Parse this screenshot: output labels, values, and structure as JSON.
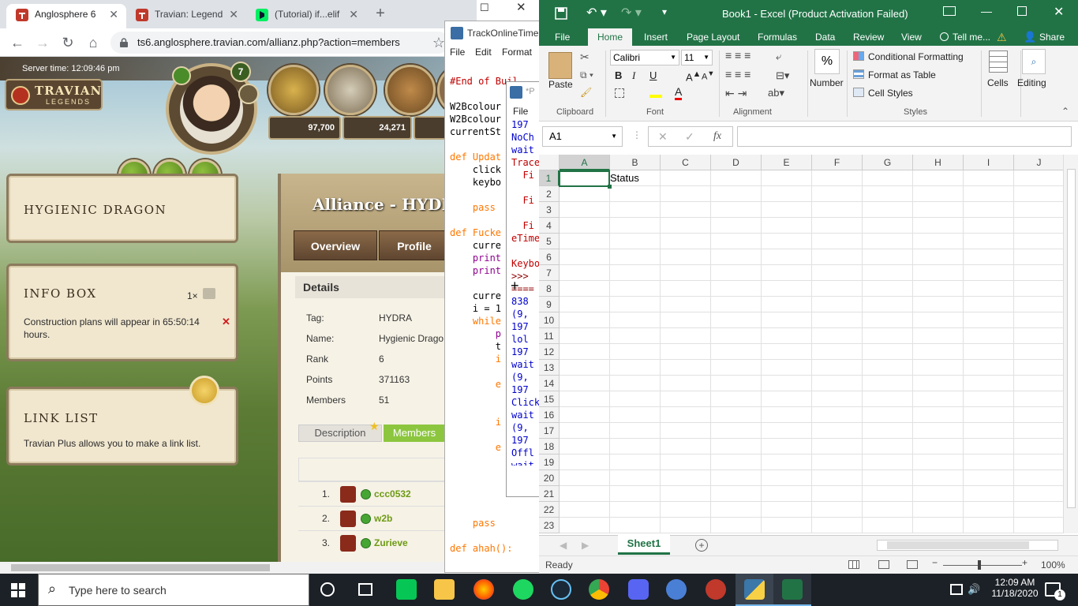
{
  "chrome": {
    "tabs": [
      {
        "title": "Anglosphere 6"
      },
      {
        "title": "Travian: Legend"
      },
      {
        "title": "(Tutorial) if...elif"
      }
    ],
    "url": "ts6.anglosphere.travian.com/allianz.php?action=members"
  },
  "travian": {
    "server_time": "Server time:  12:09:46 pm",
    "logo_line1": "TRAVIAN",
    "logo_line2": "LEGENDS",
    "level": "7",
    "wood": "97,700",
    "clay": "24,271",
    "village_name": "HYGIENIC DRAGON",
    "infobox": {
      "title": "INFO BOX",
      "count": "1×",
      "message": "Construction plans will appear in 65:50:14 hours."
    },
    "linklist": {
      "title": "LINK LIST",
      "message": "Travian Plus allows you to make a link list."
    },
    "alliance": {
      "heading": "Alliance - HYDR",
      "tab_overview": "Overview",
      "tab_profile": "Profile",
      "details_title": "Details",
      "details": [
        {
          "label": "Tag:",
          "value": "HYDRA"
        },
        {
          "label": "Name:",
          "value": "Hygienic Drago"
        },
        {
          "label": "Rank",
          "value": "6"
        },
        {
          "label": "Points",
          "value": "371163"
        },
        {
          "label": "Members",
          "value": "51"
        }
      ],
      "tab_description": "Description",
      "tab_members": "Members",
      "members": [
        {
          "rank": "1.",
          "name": "ccc0532"
        },
        {
          "rank": "2.",
          "name": "w2b"
        },
        {
          "rank": "3.",
          "name": "Zurieve"
        }
      ]
    }
  },
  "idle1": {
    "title": "TrackOnlineTime",
    "menu": [
      "File",
      "Edit",
      "Format"
    ],
    "code": [
      {
        "t": "#End of Buil",
        "c": "#c00000"
      },
      {
        "t": "",
        "c": "#000"
      },
      {
        "t": "W2Bcolour",
        "c": "#000"
      },
      {
        "t": "W2Bcolour",
        "c": "#000"
      },
      {
        "t": "currentSt",
        "c": "#000"
      },
      {
        "t": "",
        "c": "#000"
      },
      {
        "t": "def Updat",
        "c": "#ff7700"
      },
      {
        "t": "    click",
        "c": "#000"
      },
      {
        "t": "    keybo",
        "c": "#000"
      },
      {
        "t": "",
        "c": "#000"
      },
      {
        "t": "    pass",
        "c": "#ff7700"
      },
      {
        "t": "",
        "c": "#000"
      },
      {
        "t": "def Fucke",
        "c": "#ff7700"
      },
      {
        "t": "    curre",
        "c": "#000"
      },
      {
        "t": "    print",
        "c": "#900090"
      },
      {
        "t": "    print",
        "c": "#900090"
      },
      {
        "t": "",
        "c": "#000"
      },
      {
        "t": "    curre",
        "c": "#000"
      },
      {
        "t": "    i = 1",
        "c": "#000"
      },
      {
        "t": "    while",
        "c": "#ff7700"
      },
      {
        "t": "        p",
        "c": "#900090"
      },
      {
        "t": "        t",
        "c": "#000"
      },
      {
        "t": "        i",
        "c": "#ff7700"
      },
      {
        "t": "",
        "c": "#000"
      },
      {
        "t": "        e",
        "c": "#ff7700"
      },
      {
        "t": "",
        "c": "#000"
      },
      {
        "t": "",
        "c": "#000"
      },
      {
        "t": "        i",
        "c": "#ff7700"
      },
      {
        "t": "",
        "c": "#000"
      },
      {
        "t": "        e",
        "c": "#ff7700"
      },
      {
        "t": "",
        "c": "#000"
      },
      {
        "t": "",
        "c": "#000"
      },
      {
        "t": "",
        "c": "#000"
      },
      {
        "t": "",
        "c": "#000"
      },
      {
        "t": "",
        "c": "#000"
      },
      {
        "t": "    pass",
        "c": "#ff7700"
      },
      {
        "t": "",
        "c": "#000"
      },
      {
        "t": "def ahah():",
        "c": "#ff7700"
      }
    ]
  },
  "idle2": {
    "title": "*P",
    "menu": "File",
    "code": [
      {
        "t": "197",
        "c": "#0000cc"
      },
      {
        "t": "NoCh",
        "c": "#0000cc"
      },
      {
        "t": "wait",
        "c": "#0000cc"
      },
      {
        "t": "Trace",
        "c": "#c00000"
      },
      {
        "t": "  Fi",
        "c": "#c00000"
      },
      {
        "t": "    ",
        "c": "#c00000"
      },
      {
        "t": "  Fi",
        "c": "#c00000"
      },
      {
        "t": "    ",
        "c": "#c00000"
      },
      {
        "t": "  Fi",
        "c": "#c00000"
      },
      {
        "t": "eTime",
        "c": "#c00000"
      },
      {
        "t": "",
        "c": "#c00000"
      },
      {
        "t": "Keybo",
        "c": "#c00000"
      },
      {
        "t": ">>> ",
        "c": "#900000"
      },
      {
        "t": "====",
        "c": "#900000"
      },
      {
        "t": "838",
        "c": "#0000cc"
      },
      {
        "t": "(9, ",
        "c": "#0000cc"
      },
      {
        "t": "197",
        "c": "#0000cc"
      },
      {
        "t": "lol",
        "c": "#0000cc"
      },
      {
        "t": "197",
        "c": "#0000cc"
      },
      {
        "t": "wait",
        "c": "#0000cc"
      },
      {
        "t": "(9, ",
        "c": "#0000cc"
      },
      {
        "t": "197",
        "c": "#0000cc"
      },
      {
        "t": "Click",
        "c": "#0000cc"
      },
      {
        "t": "wait",
        "c": "#0000cc"
      },
      {
        "t": "(9, ",
        "c": "#0000cc"
      },
      {
        "t": "197",
        "c": "#0000cc"
      },
      {
        "t": "Offl",
        "c": "#0000cc"
      },
      {
        "t": "wait",
        "c": "#0000cc"
      }
    ]
  },
  "excel": {
    "title": "Book1 - Excel (Product Activation Failed)",
    "tabs": [
      "File",
      "Home",
      "Insert",
      "Page Layout",
      "Formulas",
      "Data",
      "Review",
      "View",
      "Tell me...",
      "Share"
    ],
    "ribbon": {
      "paste": "Paste",
      "clipboard": "Clipboard",
      "font_name": "Calibri",
      "font_size": "11",
      "font": "Font",
      "alignment": "Alignment",
      "number": "Number",
      "conditional": "Conditional Formatting",
      "format_table": "Format as Table",
      "cell_styles": "Cell Styles",
      "styles": "Styles",
      "cells": "Cells",
      "editing": "Editing",
      "bold": "B",
      "italic": "I",
      "underline": "U",
      "percent": "%"
    },
    "name_box": "A1",
    "fx": "fx",
    "columns": [
      "A",
      "B",
      "C",
      "D",
      "E",
      "F",
      "G",
      "H",
      "I",
      "J"
    ],
    "rows": [
      "1",
      "2",
      "3",
      "4",
      "5",
      "6",
      "7",
      "8",
      "9",
      "10",
      "11",
      "12",
      "13",
      "14",
      "15",
      "16",
      "17",
      "18",
      "19",
      "20",
      "21",
      "22",
      "23"
    ],
    "cell_b1": "Status",
    "sheet": "Sheet1",
    "status": "Ready",
    "zoom": "100%"
  },
  "taskbar": {
    "search_placeholder": "Type here to search",
    "time": "12:09 AM",
    "date": "11/18/2020",
    "notifications": "1"
  }
}
